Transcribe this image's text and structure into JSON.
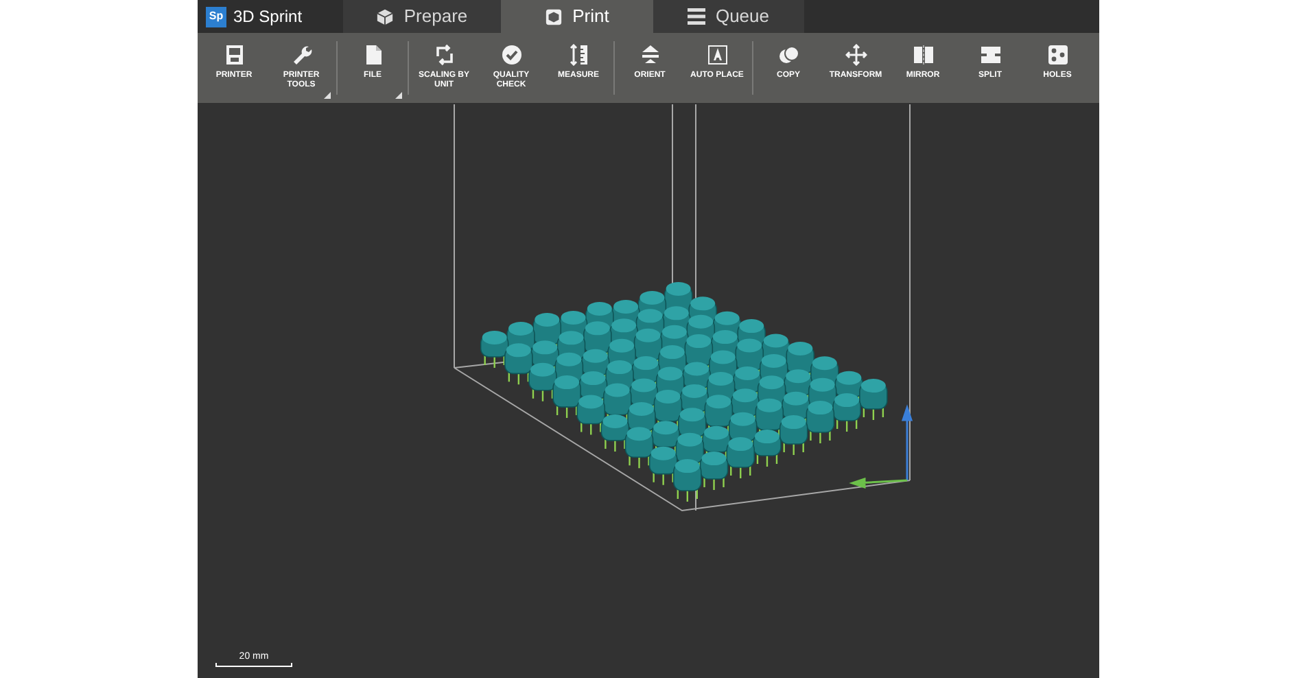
{
  "app": {
    "logo": "Sp",
    "title": "3D Sprint"
  },
  "tabs": [
    {
      "label": "Prepare",
      "selected": false
    },
    {
      "label": "Print",
      "selected": true
    },
    {
      "label": "Queue",
      "selected": false
    }
  ],
  "toolbar": [
    [
      {
        "label": "PRINTER",
        "dropdown": false
      },
      {
        "label": "PRINTER TOOLS",
        "dropdown": true
      }
    ],
    [
      {
        "label": "FILE",
        "dropdown": true
      }
    ],
    [
      {
        "label": "SCALING BY UNIT",
        "dropdown": false
      },
      {
        "label": "QUALITY CHECK",
        "dropdown": false
      },
      {
        "label": "MEASURE",
        "dropdown": false
      }
    ],
    [
      {
        "label": "ORIENT",
        "dropdown": false
      },
      {
        "label": "AUTO PLACE",
        "dropdown": false
      }
    ],
    [
      {
        "label": "COPY",
        "dropdown": false
      },
      {
        "label": "TRANSFORM",
        "dropdown": false
      },
      {
        "label": "MIRROR",
        "dropdown": false
      },
      {
        "label": "SPLIT",
        "dropdown": false
      },
      {
        "label": "HOLES",
        "dropdown": false
      }
    ]
  ],
  "scale_bar": {
    "label": "20 mm"
  }
}
